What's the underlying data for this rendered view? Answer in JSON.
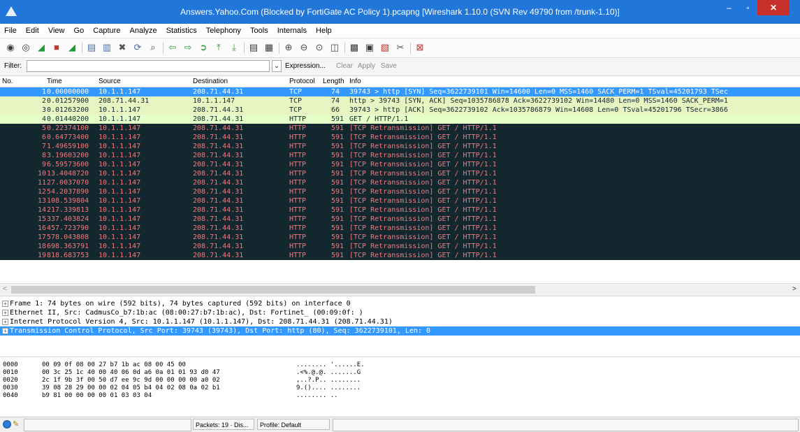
{
  "window": {
    "title": "Answers.Yahoo.Com (Blocked by FortiGate AC Policy 1).pcapng  [Wireshark 1.10.0  (SVN Rev 49790 from /trunk-1.10)]",
    "minimize": "‒",
    "maximize": "▫",
    "close": "✕"
  },
  "menu": [
    "File",
    "Edit",
    "View",
    "Go",
    "Capture",
    "Analyze",
    "Statistics",
    "Telephony",
    "Tools",
    "Internals",
    "Help"
  ],
  "toolbar": {
    "icons": [
      {
        "name": "interfaces-icon",
        "glyph": "◉",
        "color": "#3a3a3a"
      },
      {
        "name": "options-icon",
        "glyph": "◎",
        "color": "#3a3a3a"
      },
      {
        "name": "start-capture-icon",
        "glyph": "◢",
        "color": "#1f9a3a"
      },
      {
        "name": "stop-capture-icon",
        "glyph": "■",
        "color": "#c0392b"
      },
      {
        "name": "restart-capture-icon",
        "glyph": "◢",
        "color": "#1f9a3a"
      },
      {
        "name": "open-file-icon",
        "glyph": "▤",
        "color": "#4a6fa5"
      },
      {
        "name": "save-file-icon",
        "glyph": "▥",
        "color": "#4a6fa5"
      },
      {
        "name": "close-file-icon",
        "glyph": "✖",
        "color": "#555555"
      },
      {
        "name": "reload-icon",
        "glyph": "⟳",
        "color": "#4a6fa5"
      },
      {
        "name": "find-packet-icon",
        "glyph": "⌕",
        "color": "#4a4a4a"
      },
      {
        "name": "go-back-icon",
        "glyph": "⇦",
        "color": "#2e9a3e"
      },
      {
        "name": "go-forward-icon",
        "glyph": "⇨",
        "color": "#2e9a3e"
      },
      {
        "name": "go-to-packet-icon",
        "glyph": "➲",
        "color": "#2e9a3e"
      },
      {
        "name": "go-first-icon",
        "glyph": "⤒",
        "color": "#2e9a3e"
      },
      {
        "name": "go-last-icon",
        "glyph": "⤓",
        "color": "#2e9a3e"
      },
      {
        "name": "colorize-icon",
        "glyph": "▤",
        "color": "#3a3a3a"
      },
      {
        "name": "autoscroll-icon",
        "glyph": "▦",
        "color": "#3a3a3a"
      },
      {
        "name": "zoom-in-icon",
        "glyph": "⊕",
        "color": "#4a4a4a"
      },
      {
        "name": "zoom-out-icon",
        "glyph": "⊖",
        "color": "#4a4a4a"
      },
      {
        "name": "zoom-normal-icon",
        "glyph": "⊙",
        "color": "#4a4a4a"
      },
      {
        "name": "resize-columns-icon",
        "glyph": "◫",
        "color": "#4a4a4a"
      },
      {
        "name": "capture-filters-icon",
        "glyph": "▩",
        "color": "#3a3a3a"
      },
      {
        "name": "display-filters-icon",
        "glyph": "▣",
        "color": "#3a3a3a"
      },
      {
        "name": "coloring-rules-icon",
        "glyph": "▧",
        "color": "#c0392b"
      },
      {
        "name": "preferences-icon",
        "glyph": "✂",
        "color": "#555555"
      },
      {
        "name": "help-icon",
        "glyph": "⊠",
        "color": "#b0392b"
      }
    ]
  },
  "filter": {
    "label": "Filter:",
    "value": "",
    "placeholder": "",
    "dropdown": "⌄",
    "expression": "Expression...",
    "clear": "Clear",
    "apply": "Apply",
    "save": "Save"
  },
  "packet_list": {
    "columns": [
      "No.",
      "Time",
      "Source",
      "Destination",
      "Protocol",
      "Length",
      "Info"
    ],
    "colors": {
      "selected_bg": "#3399ff",
      "selected_fg": "#ffffff",
      "tcp_bg": "#e7f5c2",
      "tcp_fg": "#12272e",
      "http_bg": "#e4ffc7",
      "http_fg": "#12272e",
      "retrans_bg": "#12272e",
      "retrans_fg": "#f7787d"
    },
    "rows": [
      {
        "no": "1",
        "time": "0.00000000",
        "src": "10.1.1.147",
        "dst": "208.71.44.31",
        "proto": "TCP",
        "len": "74",
        "info": "39743 > http [SYN] Seq=3622739101 Win=14600 Len=0 MSS=1460 SACK_PERM=1 TSval=45201793 TSec",
        "style": "selected"
      },
      {
        "no": "2",
        "time": "0.01257900",
        "src": "208.71.44.31",
        "dst": "10.1.1.147",
        "proto": "TCP",
        "len": "74",
        "info": "http > 39743 [SYN, ACK] Seq=1035786878 Ack=3622739102 Win=14480 Len=0 MSS=1460 SACK_PERM=1",
        "style": "tcp"
      },
      {
        "no": "3",
        "time": "0.01263200",
        "src": "10.1.1.147",
        "dst": "208.71.44.31",
        "proto": "TCP",
        "len": "66",
        "info": "39743 > http [ACK] Seq=3622739102 Ack=1035786879 Win=14608 Len=0 TSval=45201796 TSecr=3866",
        "style": "tcp"
      },
      {
        "no": "4",
        "time": "0.01440200",
        "src": "10.1.1.147",
        "dst": "208.71.44.31",
        "proto": "HTTP",
        "len": "591",
        "info": "GET / HTTP/1.1",
        "style": "http"
      },
      {
        "no": "5",
        "time": "0.22374100",
        "src": "10.1.1.147",
        "dst": "208.71.44.31",
        "proto": "HTTP",
        "len": "591",
        "info": "[TCP Retransmission] GET / HTTP/1.1",
        "style": "retrans"
      },
      {
        "no": "6",
        "time": "0.64773400",
        "src": "10.1.1.147",
        "dst": "208.71.44.31",
        "proto": "HTTP",
        "len": "591",
        "info": "[TCP Retransmission] GET / HTTP/1.1",
        "style": "retrans"
      },
      {
        "no": "7",
        "time": "1.49659100",
        "src": "10.1.1.147",
        "dst": "208.71.44.31",
        "proto": "HTTP",
        "len": "591",
        "info": "[TCP Retransmission] GET / HTTP/1.1",
        "style": "retrans"
      },
      {
        "no": "8",
        "time": "3.19603200",
        "src": "10.1.1.147",
        "dst": "208.71.44.31",
        "proto": "HTTP",
        "len": "591",
        "info": "[TCP Retransmission] GET / HTTP/1.1",
        "style": "retrans"
      },
      {
        "no": "9",
        "time": "6.59573600",
        "src": "10.1.1.147",
        "dst": "208.71.44.31",
        "proto": "HTTP",
        "len": "591",
        "info": "[TCP Retransmission] GET / HTTP/1.1",
        "style": "retrans"
      },
      {
        "no": "10",
        "time": "13.4048720",
        "src": "10.1.1.147",
        "dst": "208.71.44.31",
        "proto": "HTTP",
        "len": "591",
        "info": "[TCP Retransmission] GET / HTTP/1.1",
        "style": "retrans"
      },
      {
        "no": "11",
        "time": "27.0037070",
        "src": "10.1.1.147",
        "dst": "208.71.44.31",
        "proto": "HTTP",
        "len": "591",
        "info": "[TCP Retransmission] GET / HTTP/1.1",
        "style": "retrans"
      },
      {
        "no": "12",
        "time": "54.2037890",
        "src": "10.1.1.147",
        "dst": "208.71.44.31",
        "proto": "HTTP",
        "len": "591",
        "info": "[TCP Retransmission] GET / HTTP/1.1",
        "style": "retrans"
      },
      {
        "no": "13",
        "time": "108.539804",
        "src": "10.1.1.147",
        "dst": "208.71.44.31",
        "proto": "HTTP",
        "len": "591",
        "info": "[TCP Retransmission] GET / HTTP/1.1",
        "style": "retrans"
      },
      {
        "no": "14",
        "time": "217.339813",
        "src": "10.1.1.147",
        "dst": "208.71.44.31",
        "proto": "HTTP",
        "len": "591",
        "info": "[TCP Retransmission] GET / HTTP/1.1",
        "style": "retrans"
      },
      {
        "no": "15",
        "time": "337.403824",
        "src": "10.1.1.147",
        "dst": "208.71.44.31",
        "proto": "HTTP",
        "len": "591",
        "info": "[TCP Retransmission] GET / HTTP/1.1",
        "style": "retrans"
      },
      {
        "no": "16",
        "time": "457.723790",
        "src": "10.1.1.147",
        "dst": "208.71.44.31",
        "proto": "HTTP",
        "len": "591",
        "info": "[TCP Retransmission] GET / HTTP/1.1",
        "style": "retrans"
      },
      {
        "no": "17",
        "time": "578.043808",
        "src": "10.1.1.147",
        "dst": "208.71.44.31",
        "proto": "HTTP",
        "len": "591",
        "info": "[TCP Retransmission] GET / HTTP/1.1",
        "style": "retrans"
      },
      {
        "no": "18",
        "time": "698.363791",
        "src": "10.1.1.147",
        "dst": "208.71.44.31",
        "proto": "HTTP",
        "len": "591",
        "info": "[TCP Retransmission] GET / HTTP/1.1",
        "style": "retrans"
      },
      {
        "no": "19",
        "time": "818.683753",
        "src": "10.1.1.147",
        "dst": "208.71.44.31",
        "proto": "HTTP",
        "len": "591",
        "info": "[TCP Retransmission] GET / HTTP/1.1",
        "style": "retrans"
      }
    ]
  },
  "scrollbar": {
    "left_arrow": "<",
    "right_arrow": ">"
  },
  "details": {
    "expander": "+",
    "rows": [
      {
        "text": "Frame 1: 74 bytes on wire (592 bits), 74 bytes captured (592 bits) on interface 0",
        "selected": false
      },
      {
        "text": "Ethernet II, Src: CadmusCo_b7:1b:ac (08:00:27:b7:1b:ac), Dst: Fortinet_        (00:09:0f:        )",
        "selected": false
      },
      {
        "text": "Internet Protocol Version 4, Src: 10.1.1.147 (10.1.1.147), Dst: 208.71.44.31 (208.71.44.31)",
        "selected": false
      },
      {
        "text": "Transmission Control Protocol, Src Port: 39743 (39743), Dst Port: http (80), Seq: 3622739101, Len: 0",
        "selected": true
      }
    ]
  },
  "bytes": {
    "rows": [
      {
        "offset": "0000",
        "hex": "00 09 0f          08 00  27 b7 1b ac 08 00 45 00",
        "ascii": "........ '......E."
      },
      {
        "offset": "0010",
        "hex": "00 3c 25 1c 40 00 40 06  0d a6 0a 01 01 93 d0 47",
        "ascii": ".<%.@.@. .......G"
      },
      {
        "offset": "0020",
        "hex": "2c 1f 9b 3f 00 50 d7 ee  9c 9d 00 00 00 00 a0 02",
        "ascii": ",..?.P.. ........"
      },
      {
        "offset": "0030",
        "hex": "39 08 28 29 00 00 02 04  05 b4 04 02 08 0a 02 b1",
        "ascii": "9.()....  ........"
      },
      {
        "offset": "0040",
        "hex": "b9 81 00 00 00 00 01 03  03 04",
        "ascii": "........ .."
      }
    ]
  },
  "status": {
    "packets": "Packets: 19 · Dis...",
    "profile": "Profile: Default",
    "ready_icon": "●",
    "edit_icon": "✎"
  }
}
